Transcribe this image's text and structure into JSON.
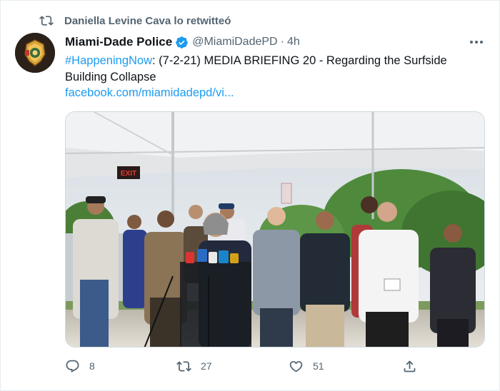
{
  "retweet": {
    "icon": "retweet-icon",
    "text": "Daniella Levine Cava lo retwitteó"
  },
  "tweet": {
    "author": {
      "display_name": "Miami-Dade Police",
      "verified": true,
      "handle": "@MiamiDadePD",
      "separator": "·",
      "time": "4h",
      "avatar": "police-badge-avatar"
    },
    "text": {
      "hashtag": "#HappeningNow",
      "body": ": (7-2-21) MEDIA BRIEFING 20 - Regarding the Surfside Building Collapse"
    },
    "link": "facebook.com/miamidadepd/vi...",
    "media": {
      "description_icon": "press-briefing-photo",
      "exit_sign": "EXIT"
    },
    "actions": {
      "replies": "8",
      "retweets": "27",
      "likes": "51"
    }
  },
  "colors": {
    "accent": "#1d9bf0",
    "secondary_text": "#536471",
    "primary_text": "#0f1419"
  }
}
